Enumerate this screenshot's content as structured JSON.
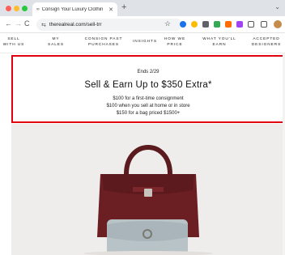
{
  "browser": {
    "tab": {
      "favicon": "∞",
      "title": "Consign Your Luxury Clothin",
      "close": "✕"
    },
    "new_tab": "+",
    "tab_chevron": "⌄",
    "nav": {
      "back": "←",
      "forward": "→",
      "reload": "C"
    },
    "site_info": "⇆",
    "url": "therealreal.com/sell-trr",
    "star": "☆"
  },
  "site_nav": {
    "items": [
      "SELL WITH US",
      "MY SALES",
      "CONSIGN PAST PURCHASES",
      "INSIGHTS",
      "HOW WE PRICE",
      "WHAT YOU'LL EARN",
      "ACCEPTED DESIGNERS"
    ]
  },
  "promo": {
    "ends": "Ends 2/29",
    "title": "Sell & Earn Up to $350 Extra*",
    "lines": [
      "$100 for a first-time consignment",
      "$100 when you sell at home or in store",
      "$150 for a bag priced $1500+"
    ]
  },
  "colors": {
    "promo_border": "#e10010",
    "handbag": "#6b1f23",
    "clutch": "#b8c3c7",
    "hero_bg": "#efedeb"
  }
}
